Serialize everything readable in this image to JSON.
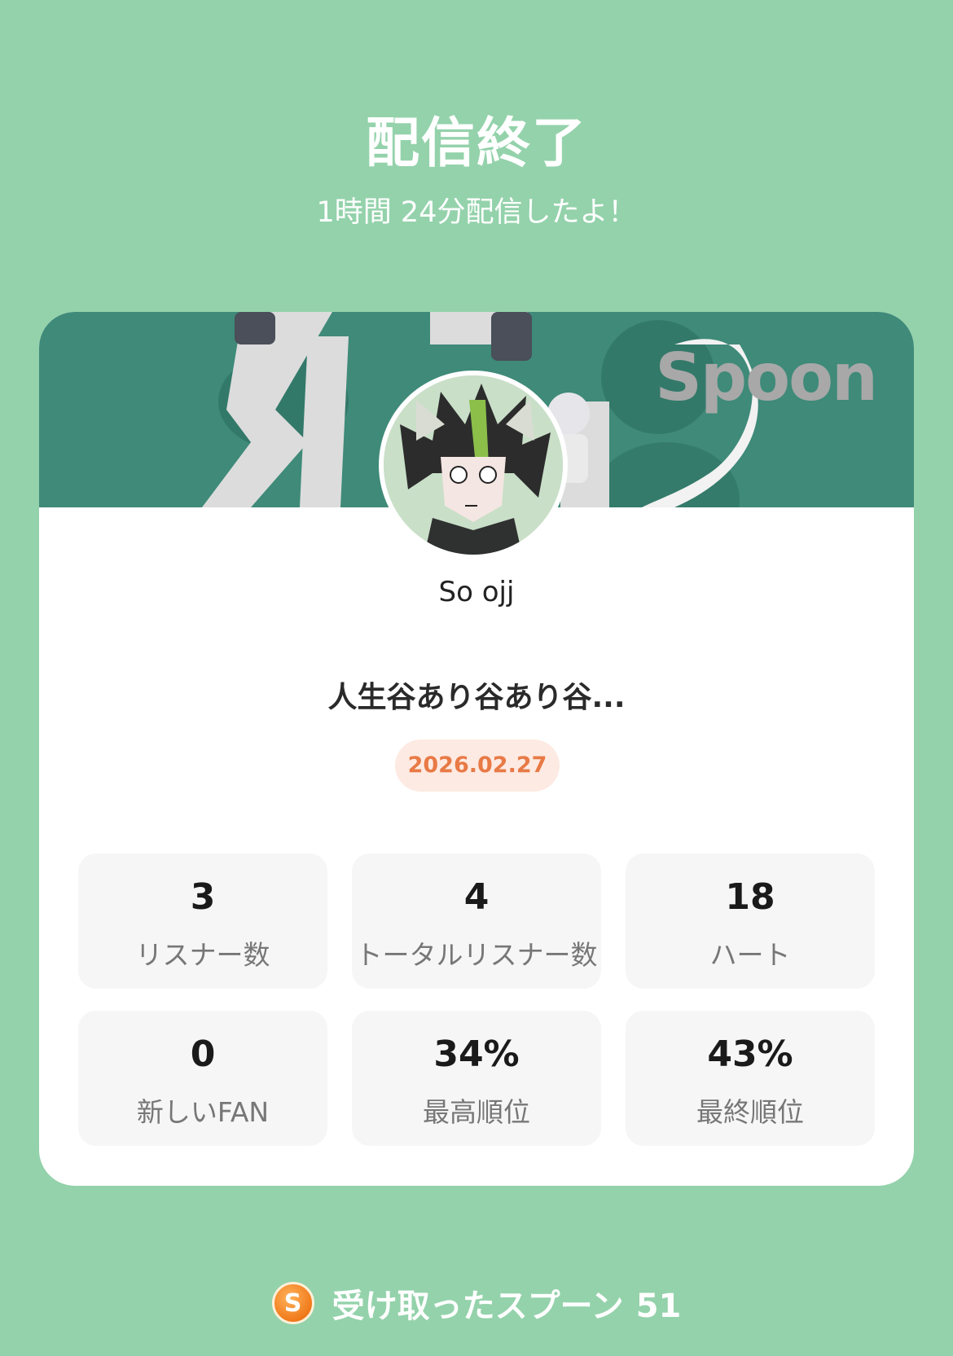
{
  "header": {
    "title": "配信終了",
    "duration_text": "1時間 24分配信したよ！"
  },
  "card": {
    "brand": "Spoon",
    "username": "So ojj",
    "live_title": "人生谷あり谷あり谷...",
    "date": "2026.02.27",
    "stats": [
      {
        "value": "3",
        "label": "リスナー数"
      },
      {
        "value": "4",
        "label": "トータルリスナー数"
      },
      {
        "value": "18",
        "label": "ハート"
      },
      {
        "value": "0",
        "label": "新しいFAN"
      },
      {
        "value": "34%",
        "label": "最高順位"
      },
      {
        "value": "43%",
        "label": "最終順位"
      }
    ]
  },
  "footer": {
    "coin_letter": "S",
    "label": "受け取ったスプーン",
    "count": "51"
  },
  "colors": {
    "background": "#94d2ab",
    "banner": "#3f8a79",
    "date_text": "#e87a46",
    "date_bg": "#fdeae2",
    "coin": "#f07a1a"
  },
  "icons": {
    "coin": "spoon-coin-icon",
    "avatar": "user-avatar"
  }
}
